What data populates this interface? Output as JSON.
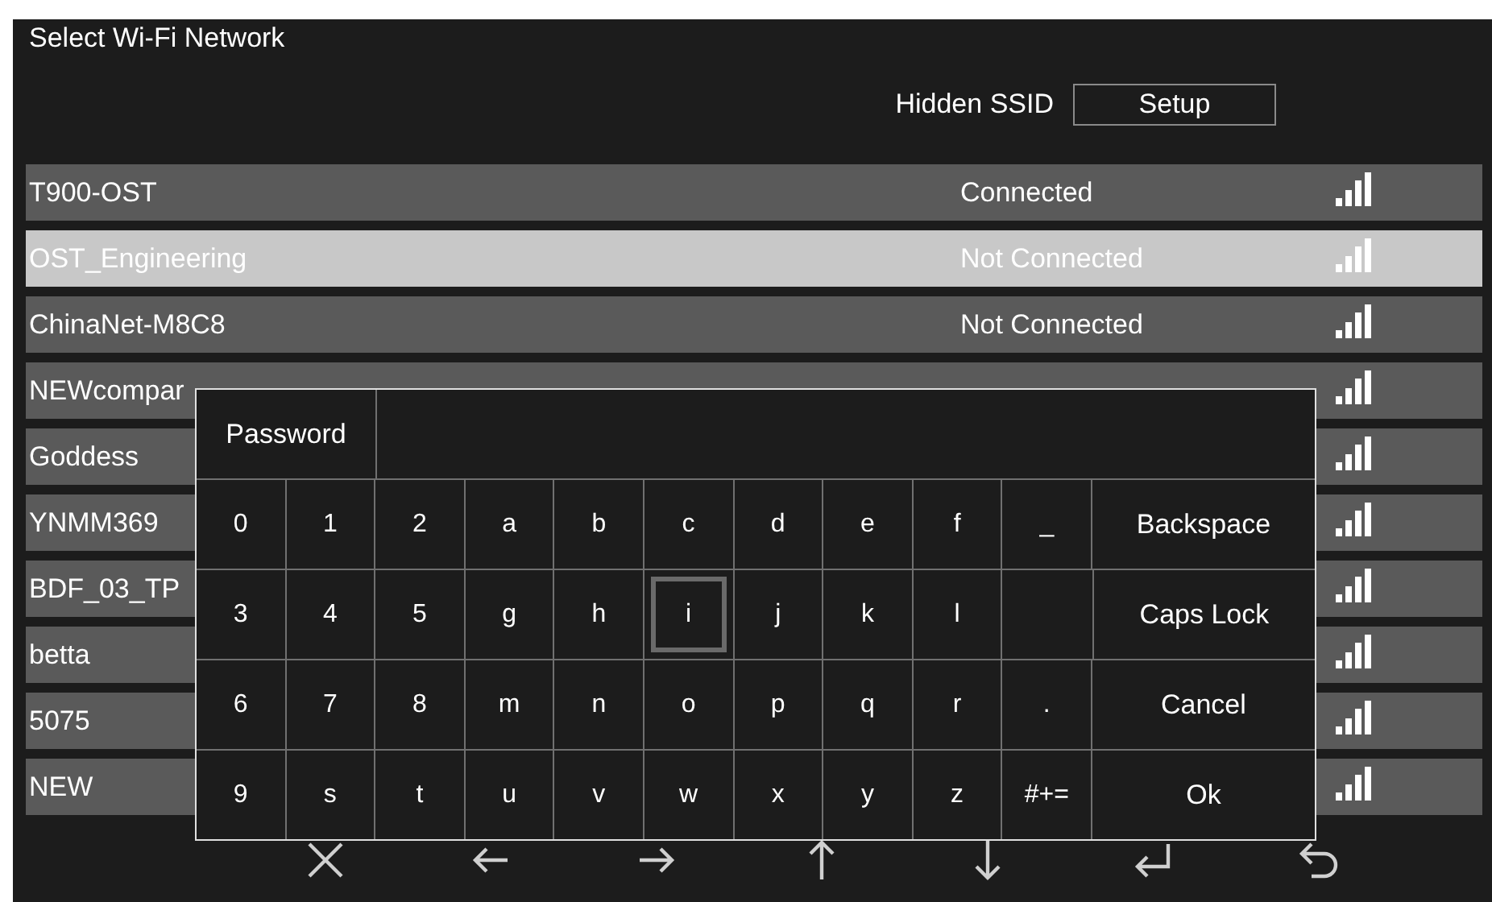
{
  "title": "Select Wi-Fi Network",
  "hidden_ssid": {
    "label": "Hidden SSID",
    "button": "Setup"
  },
  "networks": [
    {
      "name": "T900-OST",
      "status": "Connected",
      "selected": false
    },
    {
      "name": "OST_Engineering",
      "status": "Not Connected",
      "selected": true
    },
    {
      "name": "ChinaNet-M8C8",
      "status": "Not Connected",
      "selected": false
    },
    {
      "name": "NEWcompar",
      "selected": false
    },
    {
      "name": "Goddess",
      "selected": false
    },
    {
      "name": "YNMM369",
      "selected": false
    },
    {
      "name": "BDF_03_TP",
      "selected": false
    },
    {
      "name": "betta",
      "selected": false
    },
    {
      "name": "5075",
      "selected": false
    },
    {
      "name": "NEW",
      "selected": false
    }
  ],
  "keyboard": {
    "label": "Password",
    "rows": [
      {
        "keys": [
          {
            "label": "0",
            "selected": false
          },
          {
            "label": "1",
            "selected": false
          },
          {
            "label": "2",
            "selected": false
          },
          {
            "label": "a",
            "selected": false
          },
          {
            "label": "b",
            "selected": false
          },
          {
            "label": "c",
            "selected": false
          },
          {
            "label": "d",
            "selected": false
          },
          {
            "label": "e",
            "selected": false
          },
          {
            "label": "f",
            "selected": false
          },
          {
            "label": "_",
            "selected": false
          }
        ],
        "action": "Backspace"
      },
      {
        "keys": [
          {
            "label": "3",
            "selected": false
          },
          {
            "label": "4",
            "selected": false
          },
          {
            "label": "5",
            "selected": false
          },
          {
            "label": "g",
            "selected": false
          },
          {
            "label": "h",
            "selected": false
          },
          {
            "label": "i",
            "selected": true
          },
          {
            "label": "j",
            "selected": false
          },
          {
            "label": "k",
            "selected": false
          },
          {
            "label": "l",
            "selected": false
          },
          {
            "kind": "blank"
          }
        ],
        "action": "Caps Lock"
      },
      {
        "keys": [
          {
            "label": "6",
            "selected": false
          },
          {
            "label": "7",
            "selected": false
          },
          {
            "label": "8",
            "selected": false
          },
          {
            "label": "m",
            "selected": false
          },
          {
            "label": "n",
            "selected": false
          },
          {
            "label": "o",
            "selected": false
          },
          {
            "label": "p",
            "selected": false
          },
          {
            "label": "q",
            "selected": false
          },
          {
            "label": "r",
            "selected": false
          },
          {
            "label": ".",
            "selected": false
          }
        ],
        "action": "Cancel"
      },
      {
        "keys": [
          {
            "label": "9",
            "selected": false
          },
          {
            "label": "s",
            "selected": false
          },
          {
            "label": "t",
            "selected": false
          },
          {
            "label": "u",
            "selected": false
          },
          {
            "label": "v",
            "selected": false
          },
          {
            "label": "w",
            "selected": false
          },
          {
            "label": "x",
            "selected": false
          },
          {
            "label": "y",
            "selected": false
          },
          {
            "label": "z",
            "selected": false
          },
          {
            "label": "#+=",
            "selected": false
          }
        ],
        "action": "Ok"
      }
    ]
  },
  "nav": [
    {
      "kind": "close"
    },
    {
      "kind": "left"
    },
    {
      "kind": "right"
    },
    {
      "kind": "up"
    },
    {
      "kind": "down"
    },
    {
      "kind": "enter"
    },
    {
      "kind": "back"
    }
  ]
}
